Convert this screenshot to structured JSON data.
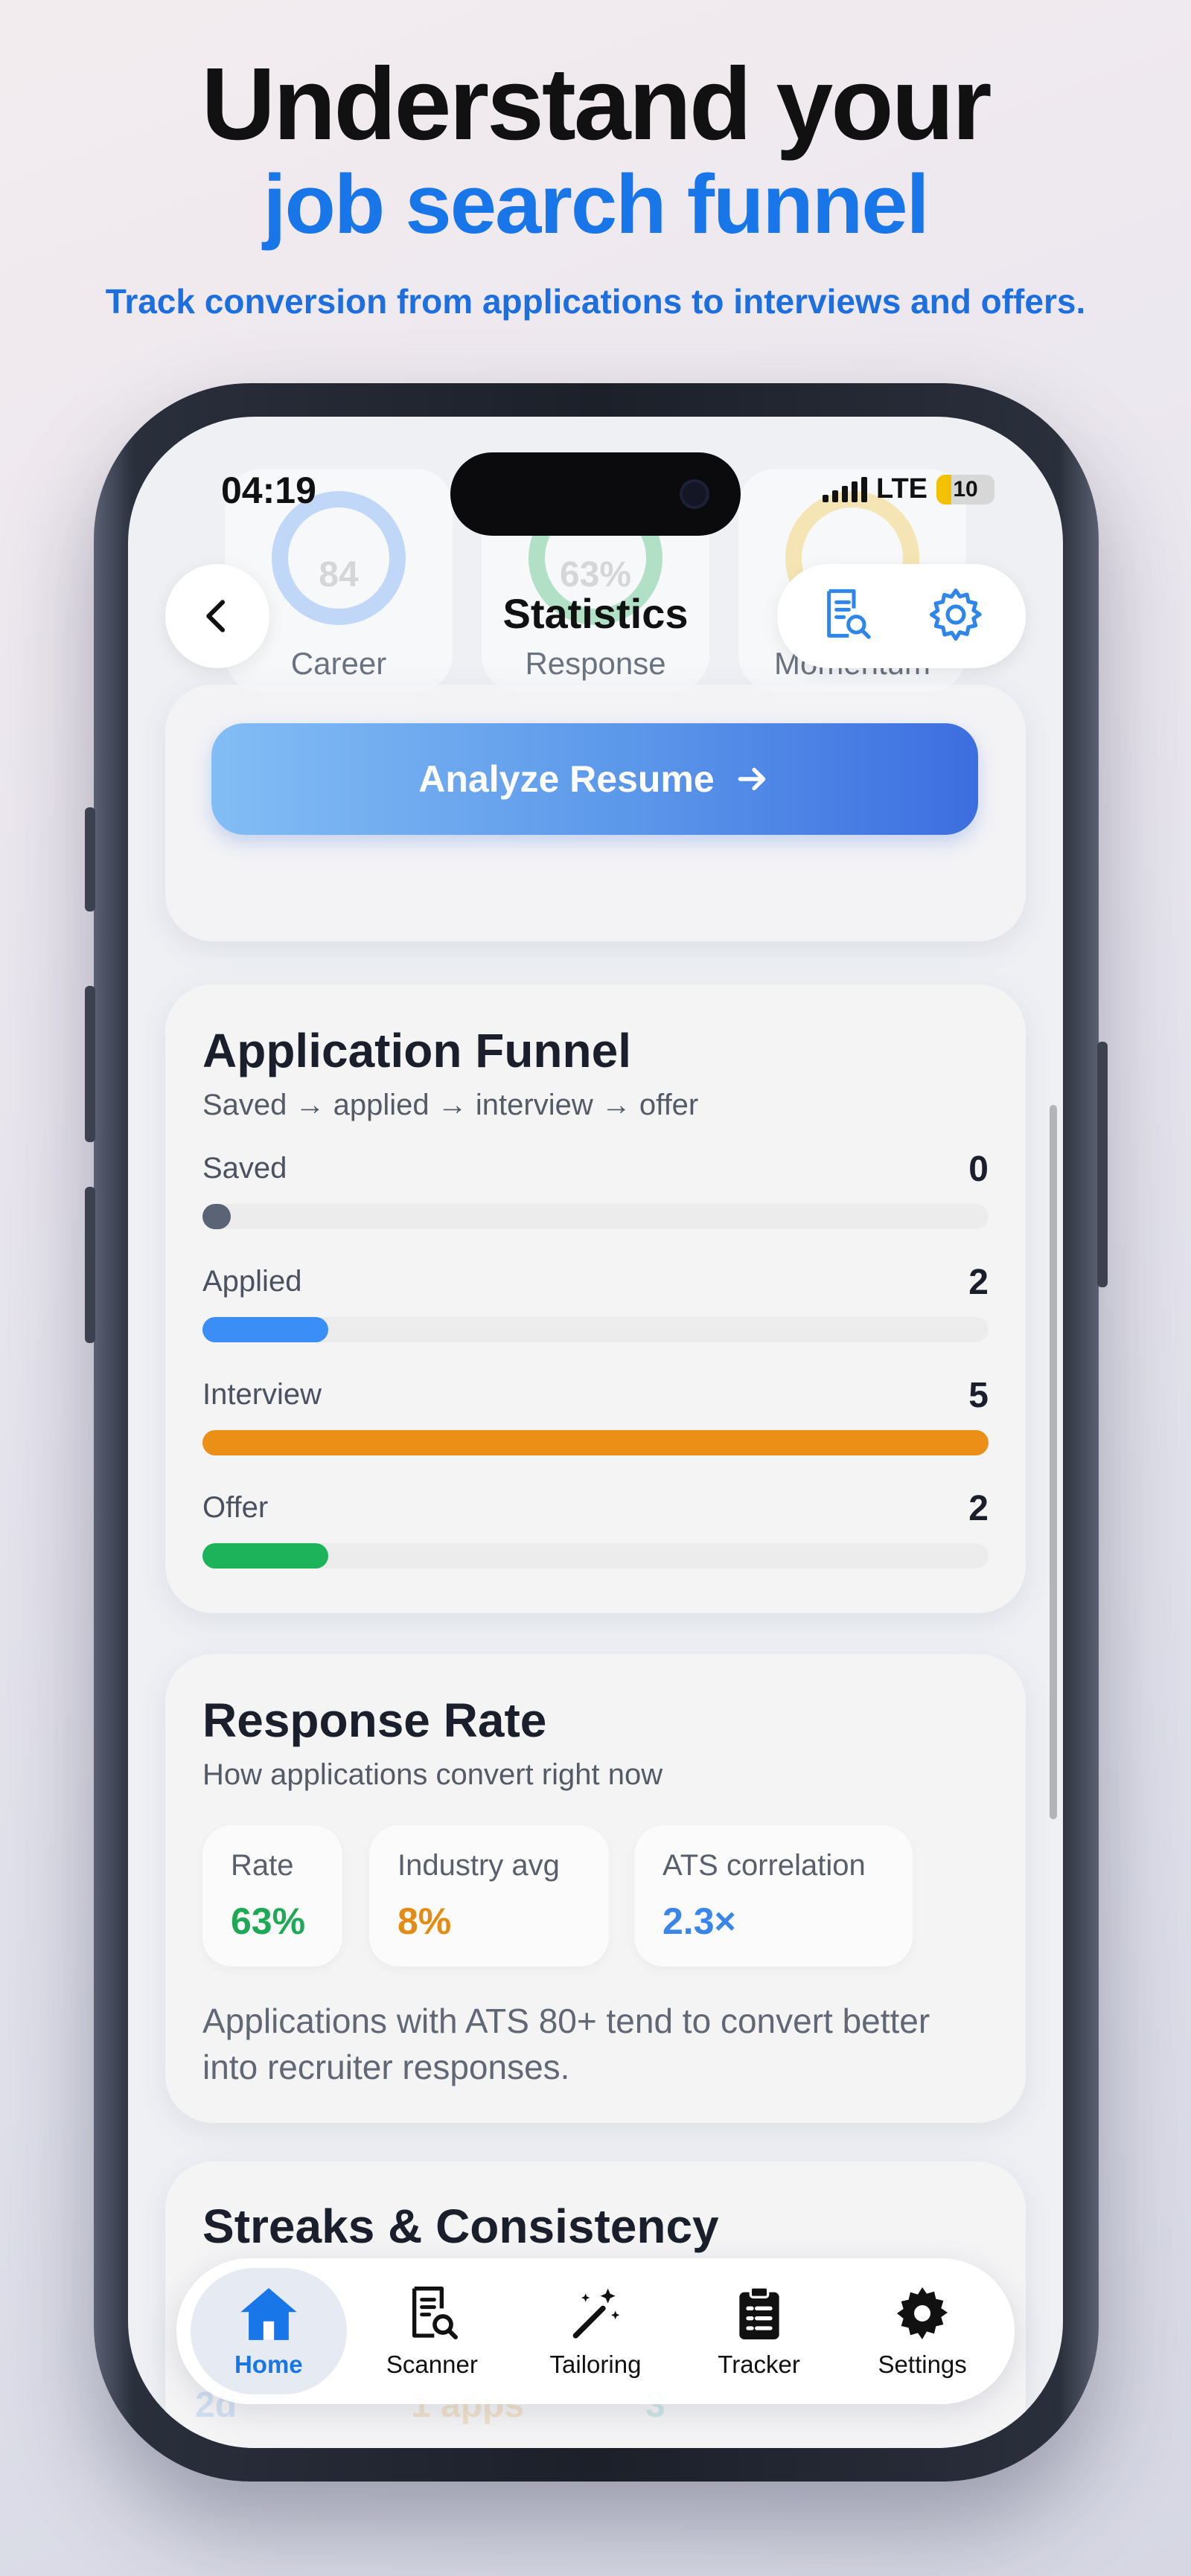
{
  "hero": {
    "title_line1": "Understand your",
    "title_line2": "job search funnel",
    "subtitle": "Track conversion from applications to interviews and offers."
  },
  "status_bar": {
    "time": "04:19",
    "network": "LTE",
    "battery": "10"
  },
  "score_cards": [
    {
      "label": "Career",
      "value": "84",
      "color": "#5b9bf0"
    },
    {
      "label": "Response",
      "value": "63%",
      "color": "#2fb463"
    },
    {
      "label": "Momentum",
      "value": "",
      "color": "#f1c232"
    }
  ],
  "nav": {
    "title": "Statistics",
    "back_icon": "chevron-left-icon",
    "actions": [
      "resume-search-icon",
      "gear-icon"
    ]
  },
  "analyze": {
    "label": "Analyze Resume",
    "icon": "arrow-right-icon"
  },
  "funnel": {
    "title": "Application Funnel",
    "subtitle": "Saved → applied → interview → offer",
    "max": 5,
    "stages": [
      {
        "label": "Saved",
        "count": "0",
        "value": 0,
        "color": "#5b6475"
      },
      {
        "label": "Applied",
        "count": "2",
        "value": 2,
        "color": "#3a8ef5"
      },
      {
        "label": "Interview",
        "count": "5",
        "value": 5,
        "color": "#ec8f16"
      },
      {
        "label": "Offer",
        "count": "2",
        "value": 2,
        "color": "#1db35a"
      }
    ]
  },
  "response": {
    "title": "Response Rate",
    "subtitle": "How applications convert right now",
    "metrics": [
      {
        "label": "Rate",
        "value": "63%",
        "color": "#1fa855"
      },
      {
        "label": "Industry avg",
        "value": "8%",
        "color": "#e38b12"
      },
      {
        "label": "ATS correlation",
        "value": "2.3×",
        "color": "#3a86e8"
      }
    ],
    "note": "Applications with ATS 80+ tend to convert better into recruiter responses."
  },
  "streaks": {
    "title": "Streaks & Consistency",
    "ghost_values": [
      {
        "text": "2d",
        "color": "#3a86e8"
      },
      {
        "text": "1 apps",
        "color": "#e38b12"
      },
      {
        "text": "3",
        "color": "#1fa8a0"
      }
    ]
  },
  "tabbar": {
    "active_color": "#1976e8",
    "tabs": [
      {
        "label": "Home",
        "icon": "home-icon",
        "active": true
      },
      {
        "label": "Scanner",
        "icon": "document-search-icon",
        "active": false
      },
      {
        "label": "Tailoring",
        "icon": "magic-wand-icon",
        "active": false
      },
      {
        "label": "Tracker",
        "icon": "clipboard-icon",
        "active": false
      },
      {
        "label": "Settings",
        "icon": "gear-icon",
        "active": false
      }
    ]
  }
}
